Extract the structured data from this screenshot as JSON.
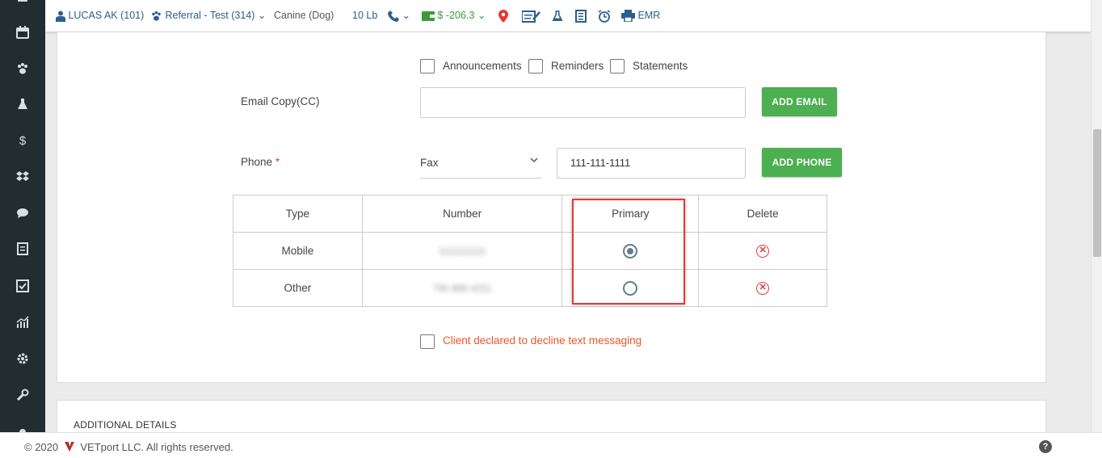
{
  "topbar": {
    "client": "LUCAS AK (101)",
    "patient": "Referral - Test (314)",
    "species": "Canine (Dog)",
    "weight": "10 Lb",
    "balance": "$ -206.3",
    "emr": "EMR"
  },
  "preferences": {
    "announcements": "Announcements",
    "reminders": "Reminders",
    "statements": "Statements"
  },
  "email_copy": {
    "label": "Email Copy(CC)",
    "value": "",
    "button": "ADD EMAIL"
  },
  "phone": {
    "label": "Phone",
    "required_mark": "*",
    "type_selected": "Fax",
    "number_value": "111-111-1111",
    "button": "ADD PHONE"
  },
  "phone_table": {
    "headers": [
      "Type",
      "Number",
      "Primary",
      "Delete"
    ],
    "rows": [
      {
        "type": "Mobile",
        "number": "1111111111",
        "primary": true
      },
      {
        "type": "Other",
        "number": "795 888 4251",
        "primary": false
      }
    ]
  },
  "decline_text": "Client declared to decline text messaging",
  "additional_details_title": "ADDITIONAL DETAILS",
  "footer": {
    "copyright": "© 2020",
    "company": "VETport LLC. All rights reserved.",
    "help": "?"
  },
  "colors": {
    "sidebar": "#222d32",
    "accent_blue": "#2c5e8f",
    "button_green": "#4caf50",
    "highlight_red": "#e53935",
    "warning_orange": "#e8572a"
  },
  "icons": [
    "calendar-icon",
    "paw-icon",
    "flask-icon",
    "dollar-icon",
    "dropbox-icon",
    "chat-icon",
    "receipt-icon",
    "checkbox-icon",
    "chart-icon",
    "gear-icon",
    "wrench-icon"
  ]
}
